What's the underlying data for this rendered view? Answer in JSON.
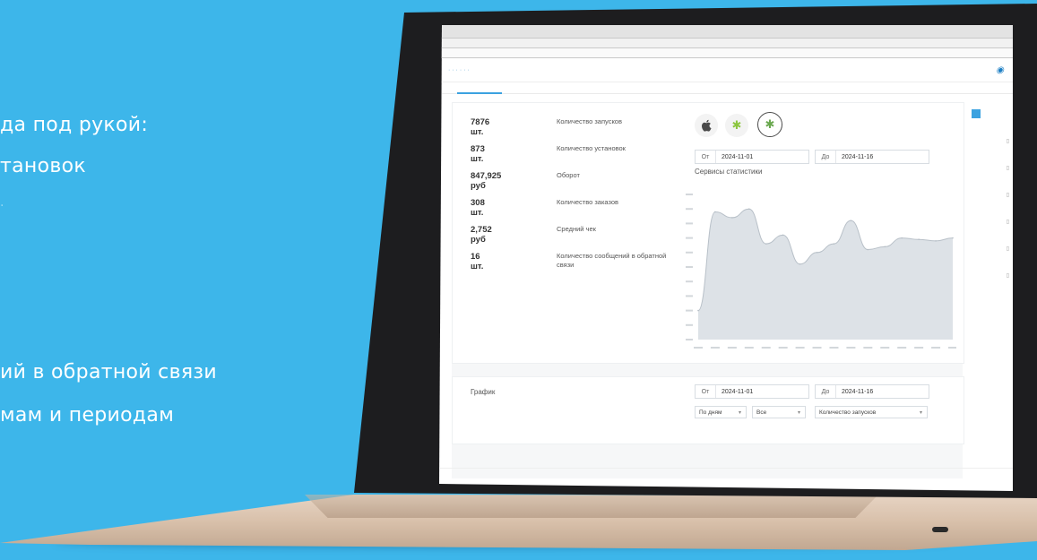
{
  "promo": {
    "line1": "да под рукой:",
    "line2": "тановок",
    "line3": "ий в обратной связи",
    "line4": "мам и периодам"
  },
  "app": {
    "stats": [
      {
        "value": "7876 шт.",
        "label": "Количество запусков"
      },
      {
        "value": "873 шт.",
        "label": "Количество установок"
      },
      {
        "value": "847,925 руб",
        "label": "Оборот"
      },
      {
        "value": "308 шт.",
        "label": "Количество заказов"
      },
      {
        "value": "2,752 руб",
        "label": "Средний чек"
      },
      {
        "value": "16 шт.",
        "label": "Количество сообщений в обратной связи"
      }
    ],
    "platform_icons": [
      "apple-icon",
      "android-icon",
      "apple-android-icon"
    ],
    "top_range": {
      "from_label": "От",
      "from_value": "2024-11-01",
      "to_label": "До",
      "to_value": "2024-11-16"
    },
    "stats_services_title": "Сервисы статистики",
    "graph_section": {
      "title": "График",
      "from_label": "От",
      "from_value": "2024-11-01",
      "to_label": "До",
      "to_value": "2024-11-16",
      "period_select": "По дням",
      "platform_select": "Все",
      "metric_select": "Количество запусков"
    }
  },
  "chart_data": {
    "type": "area",
    "title": "",
    "xlabel": "",
    "ylabel": "",
    "x": [
      1,
      2,
      3,
      4,
      5,
      6,
      7,
      8,
      9,
      10,
      11,
      12,
      13,
      14,
      15,
      16
    ],
    "values": [
      20,
      88,
      84,
      90,
      66,
      72,
      52,
      60,
      66,
      82,
      62,
      64,
      70,
      69,
      68,
      70
    ],
    "ylim": [
      0,
      100
    ],
    "grid": false,
    "fill_color": "#dde2e7",
    "line_color": "#b8c0c8"
  },
  "colors": {
    "background": "#3db6ea",
    "accent": "#1d7fc4",
    "android": "#8cc63f"
  }
}
